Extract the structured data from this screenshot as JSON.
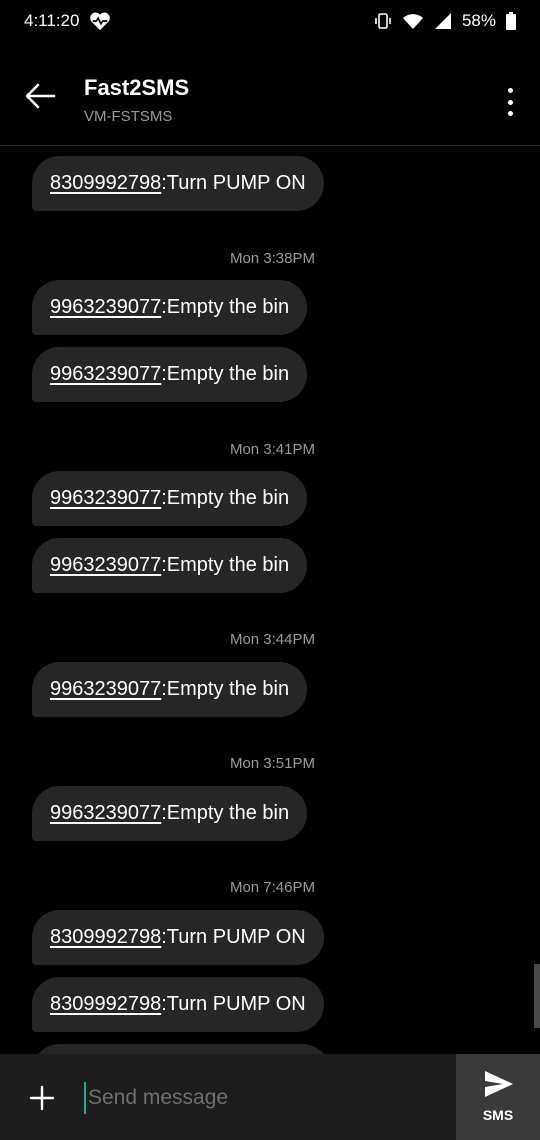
{
  "status_bar": {
    "time": "4:11:20",
    "battery": "58%"
  },
  "header": {
    "title": "Fast2SMS",
    "subtitle": "VM-FSTSMS"
  },
  "messages": [
    {
      "type": "bubble",
      "number": "8309992798",
      "text": ":Turn PUMP ON"
    },
    {
      "type": "timestamp",
      "text": "Mon 3:38PM"
    },
    {
      "type": "bubble",
      "number": "9963239077",
      "text": ":Empty the bin"
    },
    {
      "type": "bubble",
      "number": "9963239077",
      "text": ":Empty the bin"
    },
    {
      "type": "timestamp",
      "text": "Mon 3:41PM"
    },
    {
      "type": "bubble",
      "number": "9963239077",
      "text": ":Empty the bin"
    },
    {
      "type": "bubble",
      "number": "9963239077",
      "text": ":Empty the bin"
    },
    {
      "type": "timestamp",
      "text": "Mon 3:44PM"
    },
    {
      "type": "bubble",
      "number": "9963239077",
      "text": ":Empty the bin"
    },
    {
      "type": "timestamp",
      "text": "Mon 3:51PM"
    },
    {
      "type": "bubble",
      "number": "9963239077",
      "text": ":Empty the bin"
    },
    {
      "type": "timestamp",
      "text": "Mon 7:46PM"
    },
    {
      "type": "bubble",
      "number": "8309992798",
      "text": ":Turn PUMP ON"
    },
    {
      "type": "bubble",
      "number": "8309992798",
      "text": ":Turn PUMP ON"
    }
  ],
  "composer": {
    "placeholder": "Send message",
    "send_label": "SMS"
  },
  "icons": {
    "status_left": [
      "heart-pulse-icon"
    ],
    "status_right": [
      "vibrate-icon",
      "wifi-icon",
      "signal-icon",
      "battery-icon"
    ],
    "header": [
      "back-arrow-icon",
      "more-vert-icon"
    ],
    "composer": [
      "plus-icon",
      "send-icon"
    ]
  }
}
